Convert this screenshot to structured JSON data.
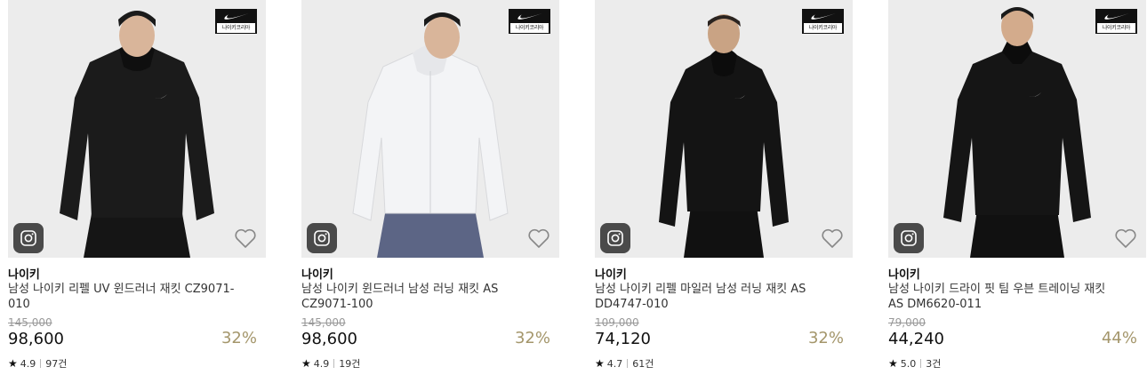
{
  "products": [
    {
      "badge_text": "나이키코리아",
      "brand": "나이키",
      "name": "남성 나이키 리펠 UV 윈드러너 재킷 CZ9071-010",
      "original_price": "145,000",
      "price": "98,600",
      "discount": "32%",
      "rating": "4.9",
      "review_count": "97건",
      "jacket_color": "#1b1b1b",
      "pants_color": "#151515"
    },
    {
      "badge_text": "나이키코리아",
      "brand": "나이키",
      "name": "남성 나이키 윈드러너 남성 러닝 재킷 AS CZ9071-100",
      "original_price": "145,000",
      "price": "98,600",
      "discount": "32%",
      "rating": "4.9",
      "review_count": "19건",
      "jacket_color": "#f3f4f6",
      "pants_color": "#5c6585"
    },
    {
      "badge_text": "나이키코리아",
      "brand": "나이키",
      "name": "남성 나이키 리펠 마일러 남성 러닝 재킷 AS DD4747-010",
      "original_price": "109,000",
      "price": "74,120",
      "discount": "32%",
      "rating": "4.7",
      "review_count": "61건",
      "jacket_color": "#141414",
      "pants_color": "#111111"
    },
    {
      "badge_text": "나이키코리아",
      "brand": "나이키",
      "name": "남성 나이키 드라이 핏 팀 우븐 트레이닝 재킷 AS DM6620-011",
      "original_price": "79,000",
      "price": "44,240",
      "discount": "44%",
      "rating": "5.0",
      "review_count": "3건",
      "jacket_color": "#151515",
      "pants_color": "#111111"
    }
  ],
  "icons": {
    "instagram": "instagram-icon",
    "wishlist": "heart-icon",
    "logo": "nike-swoosh-icon",
    "rating": "star-icon"
  },
  "colors": {
    "discount": "#a4966b",
    "image_bg": "#ececec",
    "strike": "#999999"
  }
}
